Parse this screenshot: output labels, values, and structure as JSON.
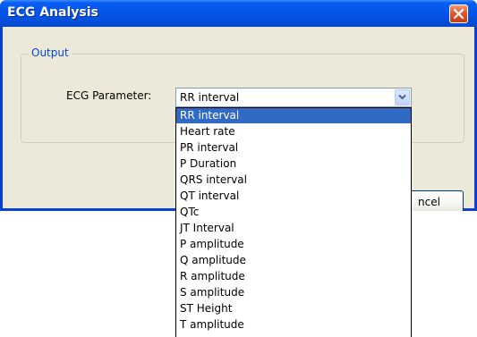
{
  "window": {
    "title": "ECG Analysis"
  },
  "group": {
    "legend": "Output"
  },
  "param": {
    "label": "ECG Parameter:",
    "selected_value": "RR interval"
  },
  "buttons": {
    "cancel_visible_text": "ncel"
  },
  "dropdown": {
    "options": [
      "RR interval",
      "Heart rate",
      "PR interval",
      "P Duration",
      "QRS interval",
      "QT interval",
      "QTc",
      "JT Interval",
      "P amplitude",
      "Q amplitude",
      "R amplitude",
      "S amplitude",
      "ST Height",
      "T amplitude"
    ],
    "highlighted_index": 0
  },
  "colors": {
    "titlebar": "#0454e8",
    "client": "#ece9d8",
    "legend_text": "#0046d5",
    "selection": "#316ac5",
    "close_button": "#e2562e"
  },
  "icons": {
    "close": "close-icon",
    "dropdown_arrow": "chevron-down-icon"
  }
}
